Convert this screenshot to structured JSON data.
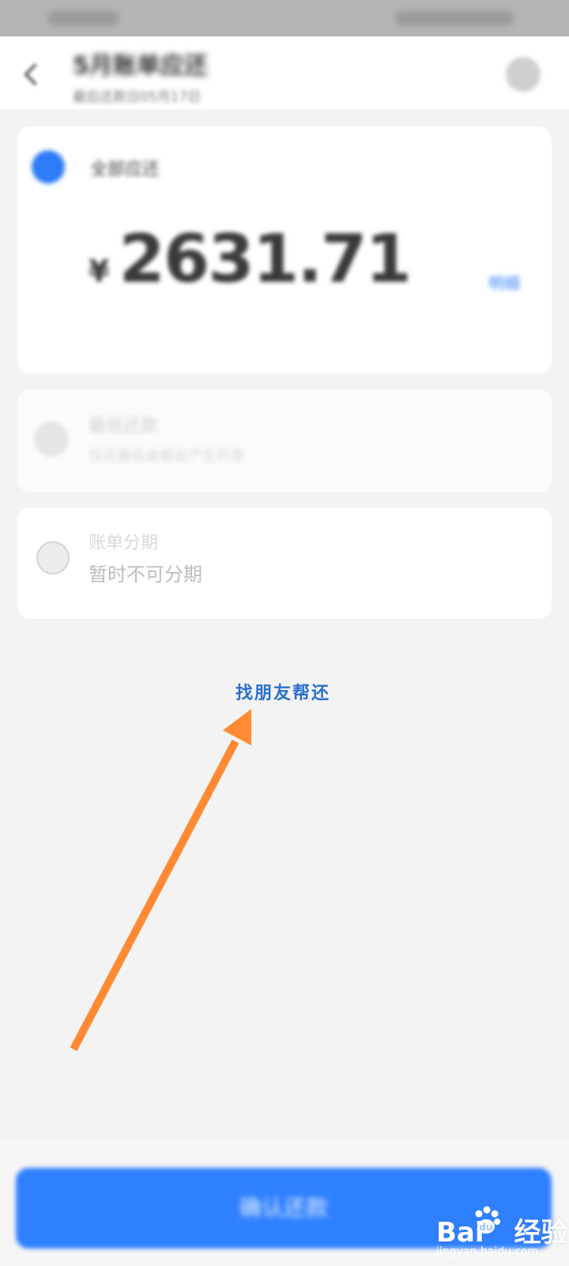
{
  "header": {
    "title": "5月账单应还",
    "subtitle": "最后还款日05月17日"
  },
  "options": {
    "full": {
      "label": "全部应还",
      "currency": "¥",
      "amount": "2631.71",
      "detail": "明细"
    },
    "minimum": {
      "label": "最低还款",
      "desc": "仅还最低金额会产生利息"
    },
    "installment": {
      "title": "账单分期",
      "status": "暂时不可分期"
    }
  },
  "friend_link": "找朋友帮还",
  "confirm_button": "确认还款",
  "watermark": {
    "logo_left": "Bai",
    "logo_right": "经验",
    "url": "jingyan.baidu.com"
  },
  "colors": {
    "accent": "#2f80ff",
    "annotation_arrow": "#ff8a33",
    "link": "#2a6fcf"
  }
}
